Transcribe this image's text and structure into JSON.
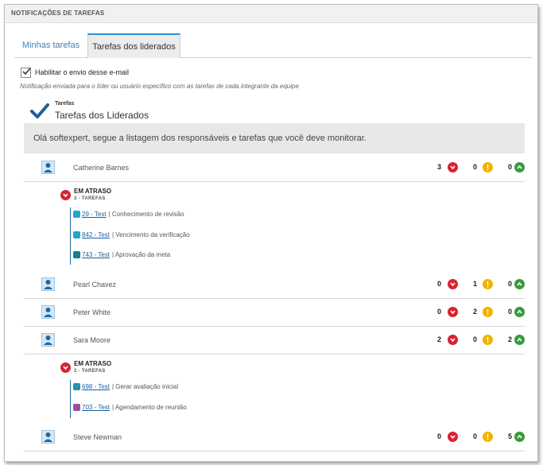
{
  "window": {
    "title": "NOTIFICAÇÕES DE TAREFAS"
  },
  "tabs": [
    {
      "label": "Minhas tarefas",
      "active": false
    },
    {
      "label": "Tarefas dos liderados",
      "active": true
    }
  ],
  "enable_email": {
    "label": "Habilitar o envio desse e-mail",
    "checked": true
  },
  "description": "Notificação enviada para o líder ou usuário específico com as tarefas de cada integrante da equipe",
  "section": {
    "label": "Tarefas",
    "title": "Tarefas dos Liderados"
  },
  "greeting": "Olá softexpert, segue a listagem dos responsáveis e tarefas que você deve monitorar.",
  "colors": {
    "late": "#d9232f",
    "warning": "#f0b400",
    "ok": "#3a9b3a",
    "link": "#1a5f9e",
    "accent": "#2d8fd5"
  },
  "people": [
    {
      "name": "Catherine Barnes",
      "late": "3",
      "warning": "0",
      "ok": "0"
    },
    {
      "name": "Pearl Chavez",
      "late": "0",
      "warning": "1",
      "ok": "0"
    },
    {
      "name": "Peter White",
      "late": "0",
      "warning": "2",
      "ok": "0"
    },
    {
      "name": "Sara Moore",
      "late": "2",
      "warning": "0",
      "ok": "2"
    },
    {
      "name": "Steve Newman",
      "late": "0",
      "warning": "0",
      "ok": "5"
    }
  ],
  "late_groups": [
    {
      "title": "EM ATRASO",
      "count": "3 - TAREFAS",
      "tasks": [
        {
          "id": "29 - Test",
          "desc": "| Conhecimento de revisão",
          "icon": "review-icon",
          "color": "#2aa3c9"
        },
        {
          "id": "842 - Test",
          "desc": "| Vencimento da verificação",
          "icon": "verification-icon",
          "color": "#2aa3c9"
        },
        {
          "id": "743 - Test",
          "desc": "| Aprovação da meta",
          "icon": "goal-icon",
          "color": "#1c7a8c"
        }
      ]
    },
    {
      "title": "EM ATRASO",
      "count": "2 - TAREFAS",
      "tasks": [
        {
          "id": "698 - Test",
          "desc": "| Gerar avaliação inicial",
          "icon": "evaluation-icon",
          "color": "#2a8fb0"
        },
        {
          "id": "703 - Test",
          "desc": "| Agendamento de reunião",
          "icon": "meeting-icon",
          "color": "#9b4f9b"
        }
      ]
    }
  ]
}
